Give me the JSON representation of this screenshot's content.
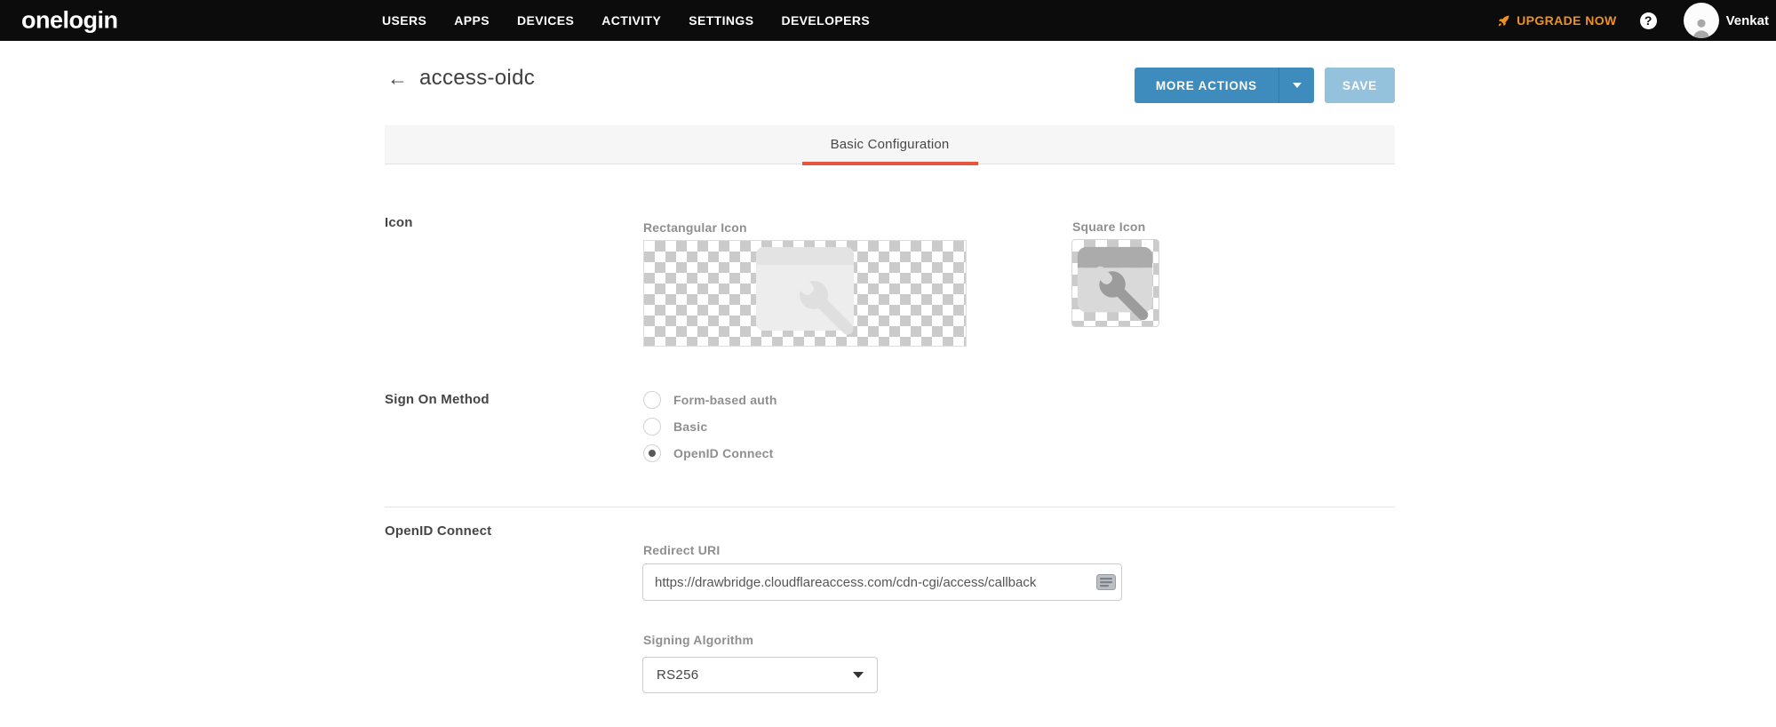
{
  "navbar": {
    "logo": "onelogin",
    "menu": [
      {
        "label": "USERS"
      },
      {
        "label": "APPS"
      },
      {
        "label": "DEVICES"
      },
      {
        "label": "ACTIVITY"
      },
      {
        "label": "SETTINGS"
      },
      {
        "label": "DEVELOPERS"
      }
    ],
    "upgrade_label": "UPGRADE NOW",
    "help_label": "?",
    "user_name": "Venkat"
  },
  "header": {
    "back_arrow": "←",
    "title": "access-oidc",
    "more_actions_label": "MORE ACTIONS",
    "save_label": "SAVE"
  },
  "tabs": {
    "active_label": "Basic Configuration"
  },
  "form": {
    "icon_section": {
      "label": "Icon",
      "rectangular_label": "Rectangular Icon",
      "square_label": "Square Icon"
    },
    "sign_on": {
      "label": "Sign On Method",
      "options": [
        {
          "label": "Form-based auth",
          "selected": false
        },
        {
          "label": "Basic",
          "selected": false
        },
        {
          "label": "OpenID Connect",
          "selected": true
        }
      ]
    },
    "oidc": {
      "label": "OpenID Connect",
      "redirect_uri_label": "Redirect URI",
      "redirect_uri_value": "https://drawbridge.cloudflareaccess.com/cdn-cgi/access/callback",
      "signing_algorithm_label": "Signing Algorithm",
      "signing_algorithm_value": "RS256"
    }
  },
  "colors": {
    "navbar_bg": "#0c0c0c",
    "accent_orange": "#EE9123",
    "tab_underline": "#E8553C",
    "button_blue": "#3E8BBE",
    "button_blue_divider": "#35799f",
    "save_disabled": "#94C1DC"
  }
}
